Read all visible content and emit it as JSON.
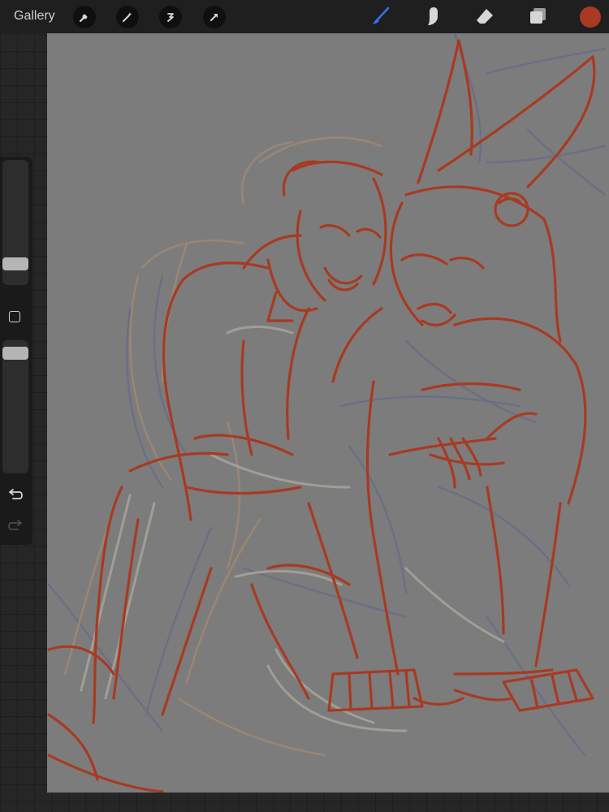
{
  "topbar": {
    "gallery_label": "Gallery",
    "left_tools": [
      "wrench-icon",
      "magic-wand-icon",
      "selection-icon",
      "transform-arrow-icon"
    ],
    "right_tools": [
      "brush-icon",
      "smudge-icon",
      "eraser-icon",
      "layers-icon"
    ],
    "active_tool": "brush-icon",
    "current_color": "#a83a22",
    "brush_accent": "#2f74e8"
  },
  "sidebar": {
    "controls": [
      "brush-size-slider",
      "modify-button",
      "opacity-slider",
      "undo-button",
      "redo-button"
    ],
    "undo_enabled": true,
    "redo_enabled": false
  },
  "canvas": {
    "background": "#7c7c7c",
    "content": "sketch-artwork",
    "sketch_colors": [
      "#a83a22",
      "#6a6e86",
      "#a08872",
      "#a8a49a"
    ]
  }
}
